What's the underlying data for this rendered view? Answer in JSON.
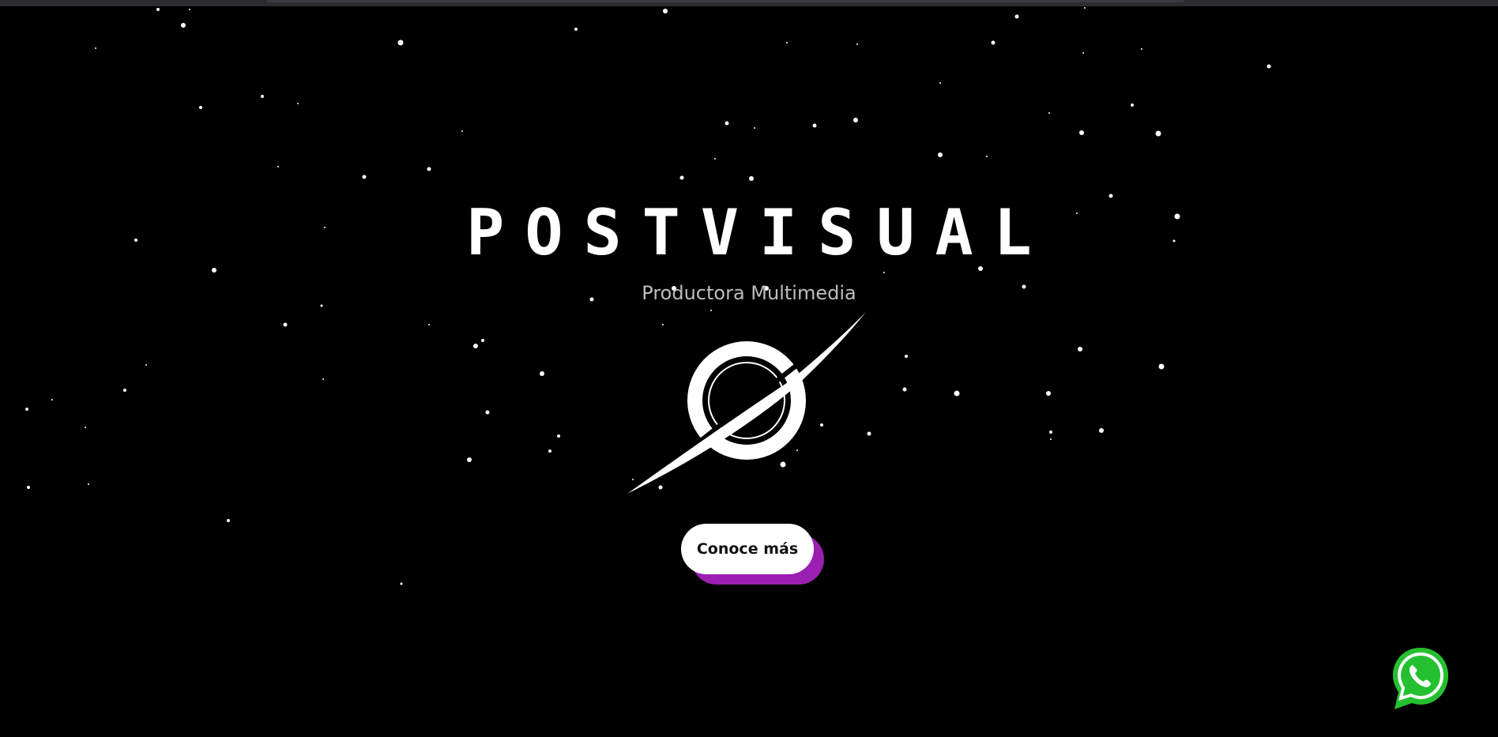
{
  "hero": {
    "title": "POSTVISUAL",
    "subtitle": "Productora Multimedia",
    "cta_label": "Conoce más"
  },
  "colors": {
    "background": "#000000",
    "cta_shadow": "#9b1fb0",
    "whatsapp_green": "#25c030"
  },
  "icons": {
    "logo": "planet-ring-logo-icon",
    "whatsapp": "whatsapp-icon"
  }
}
